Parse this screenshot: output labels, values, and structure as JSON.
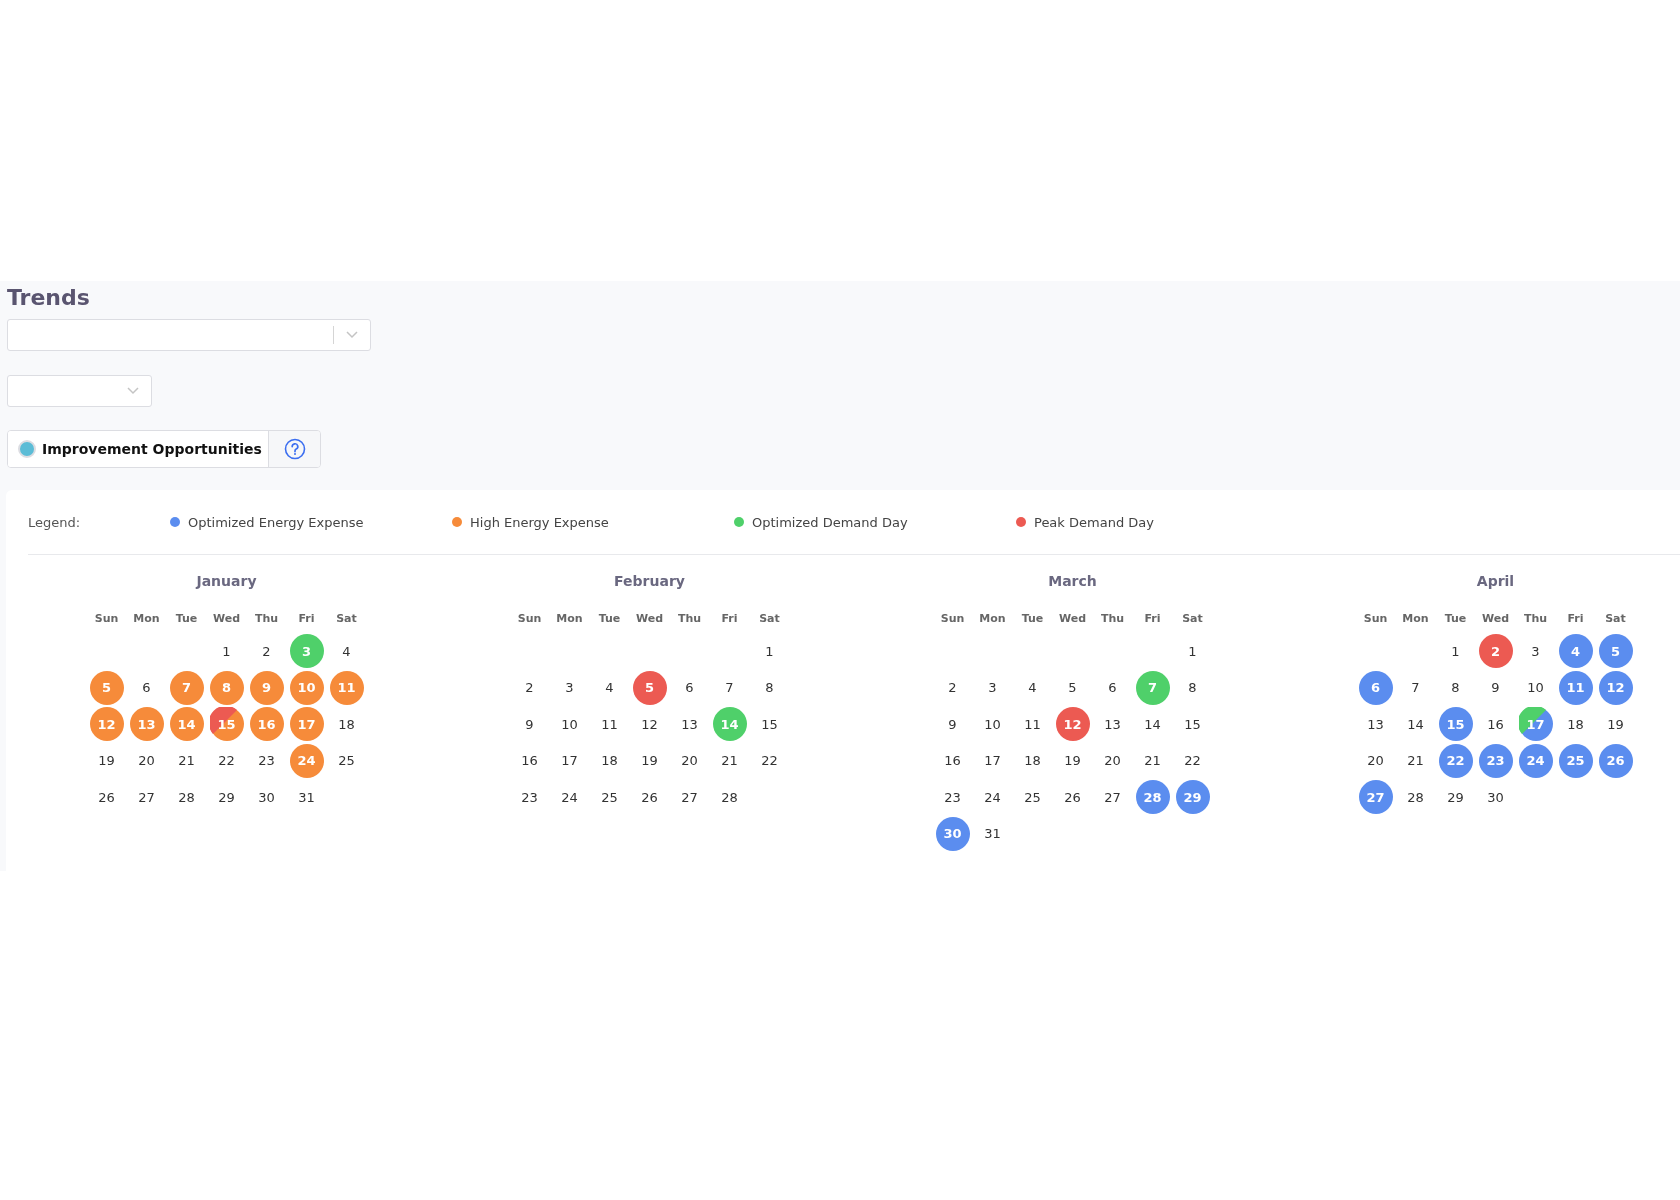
{
  "title": "Trends",
  "toggle": {
    "label": "Improvement Opportunities",
    "on": true
  },
  "legend": {
    "label": "Legend:",
    "items": [
      {
        "label": "Optimized Energy Expense",
        "color": "#5b8def"
      },
      {
        "label": "High Energy Expense",
        "color": "#f68b3a"
      },
      {
        "label": "Optimized Demand Day",
        "color": "#4fd06a"
      },
      {
        "label": "Peak Demand Day",
        "color": "#ec5a52"
      }
    ]
  },
  "months": [
    {
      "name": "January",
      "weekdays": [
        "Sun",
        "Mon",
        "Tue",
        "Wed",
        "Thu",
        "Fri",
        "Sat"
      ],
      "weeks": [
        [
          {
            "day": "1"
          },
          {
            "day": "2"
          },
          {
            "day": "3",
            "color": "#4fd06a"
          },
          {
            "day": "4"
          }
        ],
        [
          {
            "day": "5",
            "color": "#f68b3a"
          },
          {
            "day": "6"
          },
          {
            "day": "7",
            "color": "#f68b3a"
          },
          {
            "day": "8",
            "color": "#f68b3a"
          },
          {
            "day": "9",
            "color": "#f68b3a"
          },
          {
            "day": "10",
            "color": "#f68b3a"
          },
          {
            "day": "11",
            "color": "#f68b3a"
          }
        ],
        [
          {
            "day": "12",
            "color": "#f68b3a"
          },
          {
            "day": "13",
            "color": "#f68b3a"
          },
          {
            "day": "14",
            "color": "#f68b3a"
          },
          {
            "day": "15",
            "color": "#f68b3a",
            "overlay": {
              "color": "#ec5a52"
            }
          },
          {
            "day": "16",
            "color": "#f68b3a"
          },
          {
            "day": "17",
            "color": "#f68b3a"
          },
          {
            "day": "18"
          }
        ],
        [
          {
            "day": "19"
          },
          {
            "day": "20"
          },
          {
            "day": "21"
          },
          {
            "day": "22"
          },
          {
            "day": "23"
          },
          {
            "day": "24",
            "color": "#f68b3a"
          },
          {
            "day": "25"
          }
        ],
        [
          {
            "day": "26"
          },
          {
            "day": "27"
          },
          {
            "day": "28"
          },
          {
            "day": "29"
          },
          {
            "day": "30"
          },
          {
            "day": "31"
          }
        ]
      ]
    },
    {
      "name": "February",
      "weekdays": [
        "Sun",
        "Mon",
        "Tue",
        "Wed",
        "Thu",
        "Fri",
        "Sat"
      ],
      "weeks": [
        [
          {
            "day": "1"
          }
        ],
        [
          {
            "day": "2"
          },
          {
            "day": "3"
          },
          {
            "day": "4"
          },
          {
            "day": "5",
            "color": "#ec5a52"
          },
          {
            "day": "6"
          },
          {
            "day": "7"
          },
          {
            "day": "8"
          }
        ],
        [
          {
            "day": "9"
          },
          {
            "day": "10"
          },
          {
            "day": "11"
          },
          {
            "day": "12"
          },
          {
            "day": "13"
          },
          {
            "day": "14",
            "color": "#4fd06a"
          },
          {
            "day": "15"
          }
        ],
        [
          {
            "day": "16"
          },
          {
            "day": "17"
          },
          {
            "day": "18"
          },
          {
            "day": "19"
          },
          {
            "day": "20"
          },
          {
            "day": "21"
          },
          {
            "day": "22"
          }
        ],
        [
          {
            "day": "23"
          },
          {
            "day": "24"
          },
          {
            "day": "25"
          },
          {
            "day": "26"
          },
          {
            "day": "27"
          },
          {
            "day": "28"
          }
        ]
      ]
    },
    {
      "name": "March",
      "weekdays": [
        "Sun",
        "Mon",
        "Tue",
        "Wed",
        "Thu",
        "Fri",
        "Sat"
      ],
      "weeks": [
        [
          {
            "day": "1"
          }
        ],
        [
          {
            "day": "2"
          },
          {
            "day": "3"
          },
          {
            "day": "4"
          },
          {
            "day": "5"
          },
          {
            "day": "6"
          },
          {
            "day": "7",
            "color": "#4fd06a"
          },
          {
            "day": "8"
          }
        ],
        [
          {
            "day": "9"
          },
          {
            "day": "10"
          },
          {
            "day": "11"
          },
          {
            "day": "12",
            "color": "#ec5a52"
          },
          {
            "day": "13"
          },
          {
            "day": "14"
          },
          {
            "day": "15"
          }
        ],
        [
          {
            "day": "16"
          },
          {
            "day": "17"
          },
          {
            "day": "18"
          },
          {
            "day": "19"
          },
          {
            "day": "20"
          },
          {
            "day": "21"
          },
          {
            "day": "22"
          }
        ],
        [
          {
            "day": "23"
          },
          {
            "day": "24"
          },
          {
            "day": "25"
          },
          {
            "day": "26"
          },
          {
            "day": "27"
          },
          {
            "day": "28",
            "color": "#5b8def"
          },
          {
            "day": "29",
            "color": "#5b8def"
          }
        ],
        [
          {
            "day": "30",
            "color": "#5b8def"
          },
          {
            "day": "31"
          }
        ]
      ]
    },
    {
      "name": "April",
      "weekdays": [
        "Sun",
        "Mon",
        "Tue",
        "Wed",
        "Thu",
        "Fri",
        "Sat"
      ],
      "weeks": [
        [
          {
            "day": "1"
          },
          {
            "day": "2",
            "color": "#ec5a52"
          },
          {
            "day": "3"
          },
          {
            "day": "4",
            "color": "#5b8def"
          },
          {
            "day": "5",
            "color": "#5b8def"
          }
        ],
        [
          {
            "day": "6",
            "color": "#5b8def"
          },
          {
            "day": "7"
          },
          {
            "day": "8"
          },
          {
            "day": "9"
          },
          {
            "day": "10"
          },
          {
            "day": "11",
            "color": "#5b8def"
          },
          {
            "day": "12",
            "color": "#5b8def"
          }
        ],
        [
          {
            "day": "13"
          },
          {
            "day": "14"
          },
          {
            "day": "15",
            "color": "#5b8def"
          },
          {
            "day": "16"
          },
          {
            "day": "17",
            "color": "#5b8def",
            "overlay": {
              "color": "#4fd06a"
            }
          },
          {
            "day": "18"
          },
          {
            "day": "19"
          }
        ],
        [
          {
            "day": "20"
          },
          {
            "day": "21"
          },
          {
            "day": "22",
            "color": "#5b8def"
          },
          {
            "day": "23",
            "color": "#5b8def"
          },
          {
            "day": "24",
            "color": "#5b8def"
          },
          {
            "day": "25",
            "color": "#5b8def"
          },
          {
            "day": "26",
            "color": "#5b8def"
          }
        ],
        [
          {
            "day": "27",
            "color": "#5b8def"
          },
          {
            "day": "28"
          },
          {
            "day": "29"
          },
          {
            "day": "30"
          }
        ]
      ]
    }
  ]
}
